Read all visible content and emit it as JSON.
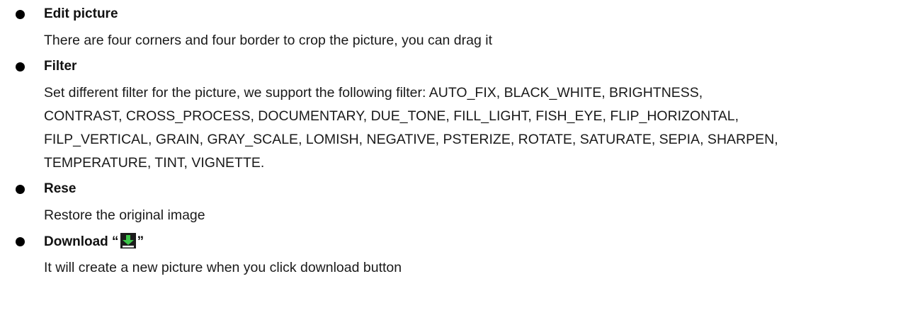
{
  "items": [
    {
      "title": "Edit picture",
      "description_lines": [
        "There are four corners and four border to crop the picture, you can drag it"
      ]
    },
    {
      "title": "Filter",
      "description_lines": [
        "Set different filter for the picture, we support the following filter: AUTO_FIX, BLACK_WHITE, BRIGHTNESS,",
        "CONTRAST, CROSS_PROCESS, DOCUMENTARY, DUE_TONE, FILL_LIGHT, FISH_EYE, FLIP_HORIZONTAL,",
        "FILP_VERTICAL, GRAIN, GRAY_SCALE, LOMISH, NEGATIVE, PSTERIZE, ROTATE, SATURATE, SEPIA, SHARPEN,",
        "TEMPERATURE, TINT, VIGNETTE."
      ]
    },
    {
      "title": "Rese",
      "description_lines": [
        "Restore the original image"
      ]
    },
    {
      "title_prefix": "Download “",
      "title_suffix": "”",
      "title_icon": "download-icon",
      "description_lines": [
        "It will create a new picture when you click download button"
      ]
    }
  ],
  "colors": {
    "text": "#1a1a1a",
    "bullet": "#000000",
    "icon_background": "#1c1c1c",
    "icon_arrow": "#3cc64a"
  }
}
